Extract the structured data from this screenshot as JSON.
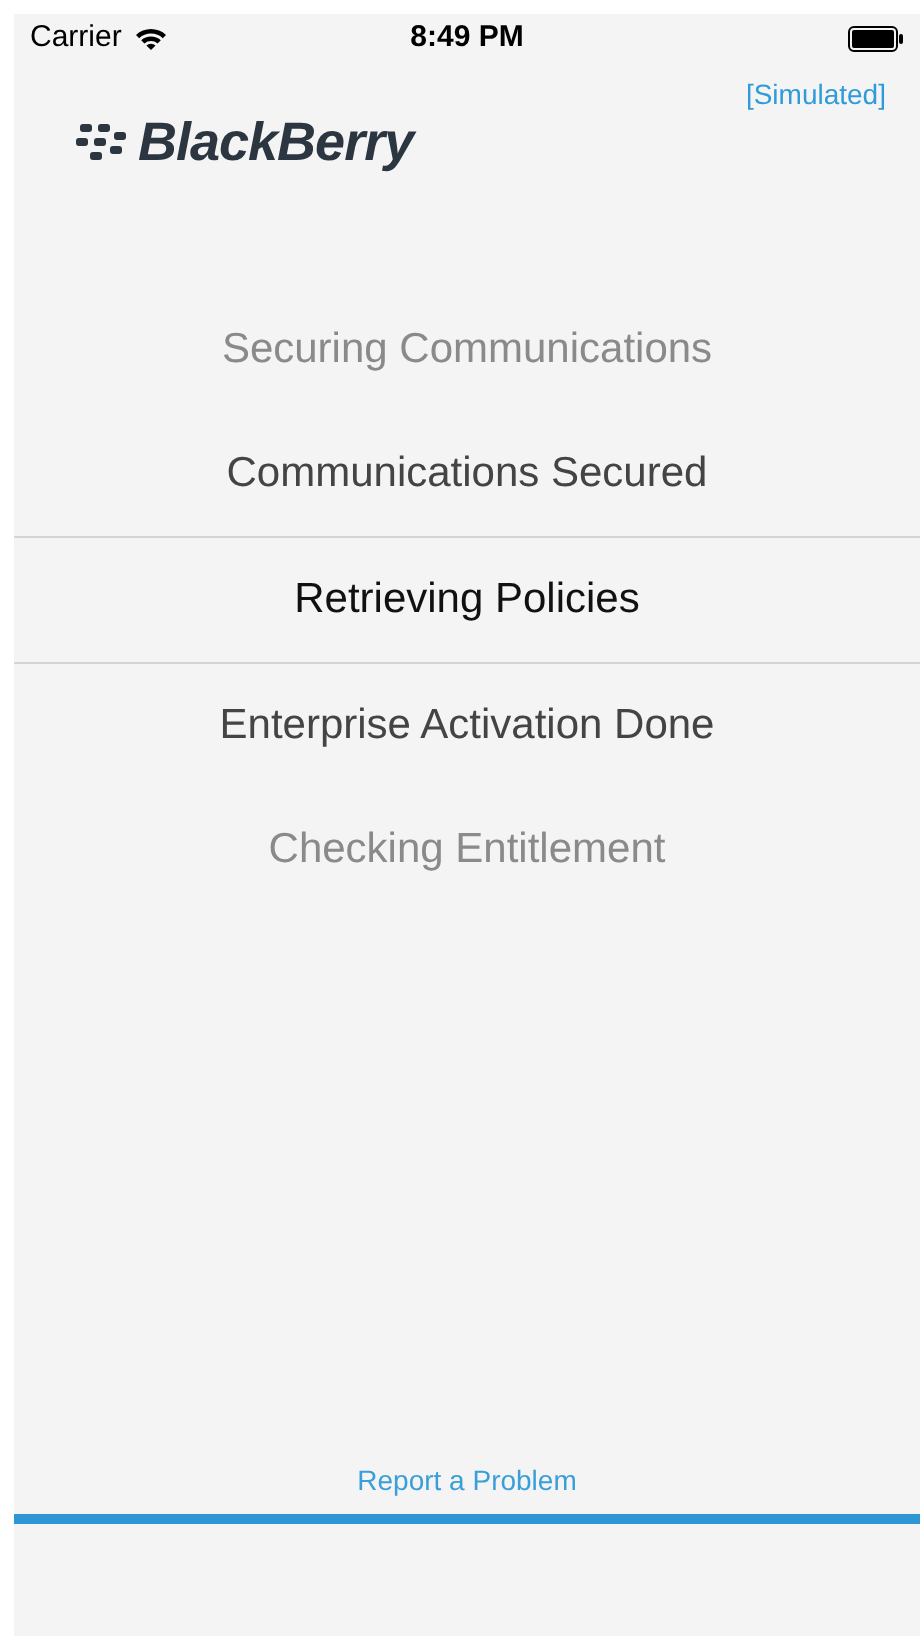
{
  "status_bar": {
    "carrier": "Carrier",
    "time": "8:49 PM"
  },
  "header": {
    "logo_text": "BlackBerry",
    "mode": "[Simulated]"
  },
  "steps": [
    {
      "label": "Securing Communications",
      "selected": false,
      "dimmed": true
    },
    {
      "label": "Communications Secured",
      "selected": false,
      "dimmed": false
    },
    {
      "label": "Retrieving Policies",
      "selected": true,
      "dimmed": false
    },
    {
      "label": "Enterprise Activation Done",
      "selected": false,
      "dimmed": false
    },
    {
      "label": "Checking Entitlement",
      "selected": false,
      "dimmed": true
    }
  ],
  "footer": {
    "link": "Report a Problem"
  }
}
